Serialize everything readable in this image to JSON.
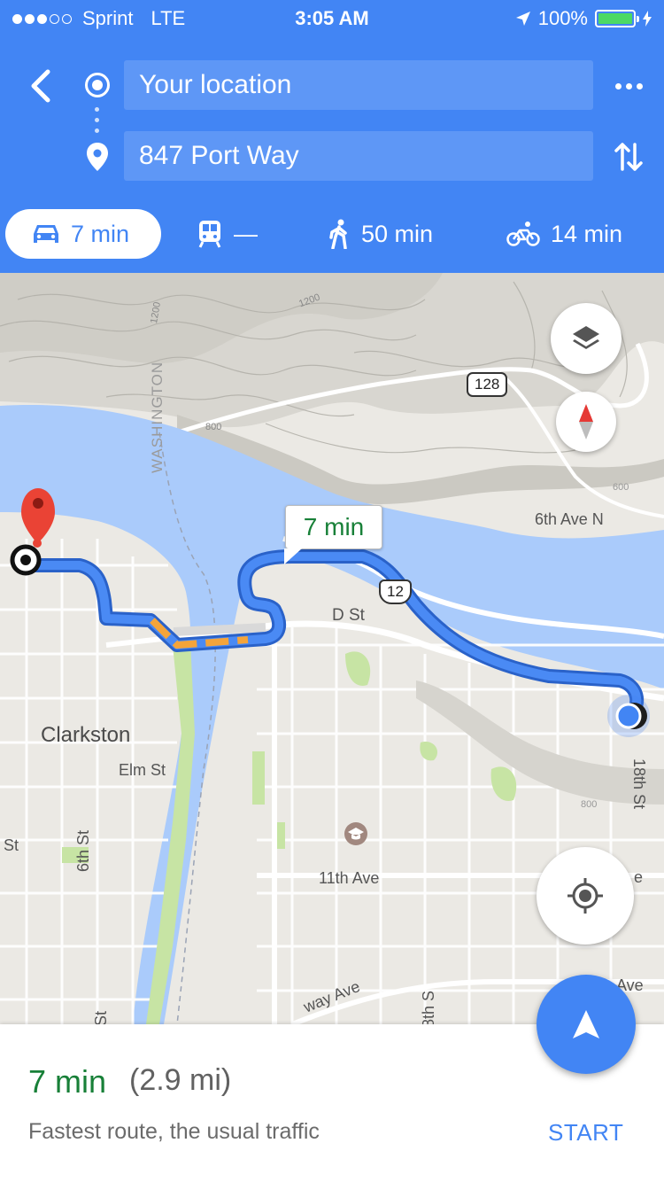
{
  "status_bar": {
    "carrier": "Sprint",
    "network": "LTE",
    "time": "3:05 AM",
    "battery": "100%",
    "signal_bars_filled": 3,
    "signal_bars_total": 5
  },
  "directions": {
    "origin": "Your location",
    "destination": "847 Port Way",
    "icons": {
      "back": "back-arrow-icon",
      "origin": "origin-dot-icon",
      "destination": "destination-pin-icon",
      "more": "more-dots-icon",
      "swap": "swap-icon"
    }
  },
  "modes": [
    {
      "id": "drive",
      "icon": "car-icon",
      "label": "7 min",
      "selected": true
    },
    {
      "id": "transit",
      "icon": "train-icon",
      "label": "—",
      "selected": false
    },
    {
      "id": "walk",
      "icon": "walk-icon",
      "label": "50 min",
      "selected": false
    },
    {
      "id": "bike",
      "icon": "bike-icon",
      "label": "14 min",
      "selected": false
    }
  ],
  "map": {
    "route_bubble": "7 min",
    "labels": {
      "washington": "WASHINGTON",
      "sixth_ave_n": "6th Ave N",
      "d_st": "D St",
      "clarkston": "Clarkston",
      "elm_st": "Elm St",
      "st": "St",
      "sixth_st": "6th St",
      "eleventh_ave": "11th Ave",
      "eighteenth_st": "18th St",
      "e": "e",
      "ave": "Ave",
      "way_ave": "way Ave",
      "eighth_s": "8th S",
      "st_bottom": "St"
    },
    "contours": {
      "c1200a": "1200",
      "c1200b": "1200",
      "c800": "800",
      "c600": "600",
      "c800b": "800"
    },
    "shields": {
      "route_128": "128",
      "route_12": "12"
    },
    "colors": {
      "water": "#aacbfb",
      "route": "#4a8af4",
      "route_outline": "#2a62c9",
      "traffic_slow": "#f4a43a",
      "park": "#c7e4a4"
    }
  },
  "sheet": {
    "time": "7 min",
    "distance": "(2.9 mi)",
    "description": "Fastest route, the usual traffic",
    "start": "START"
  }
}
